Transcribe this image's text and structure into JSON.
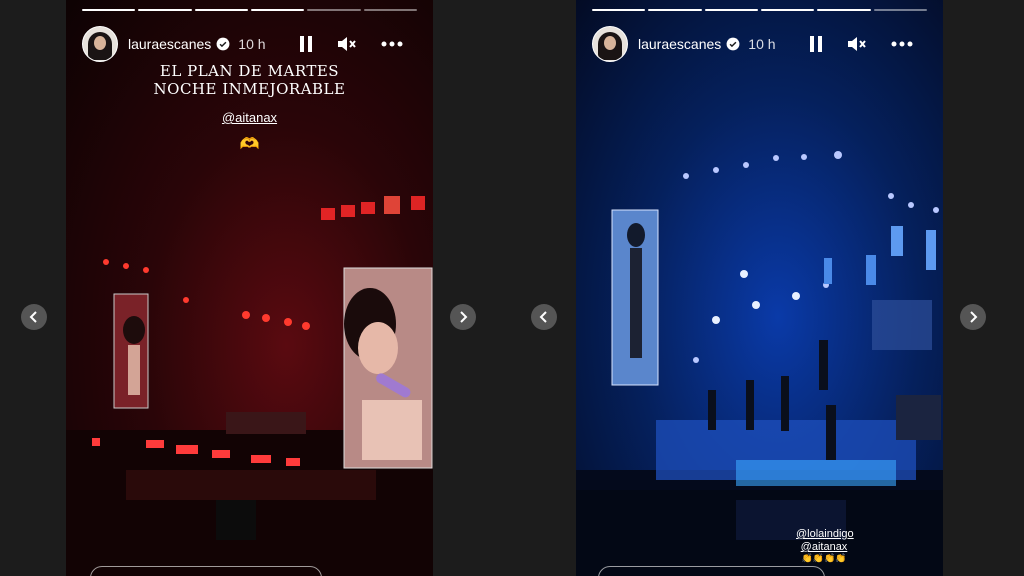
{
  "stories": [
    {
      "username": "lauraescanes",
      "time": "10 h",
      "caption_line1": "EL PLAN DE MARTES",
      "caption_line2": "NOCHE INMEJORABLE",
      "mention": "@aitanax",
      "emoji": "🫶"
    },
    {
      "username": "lauraescanes",
      "time": "10 h",
      "mention1": "@lolaindigo",
      "mention2": "@aitanax",
      "emoji": "👏👏👏👏"
    }
  ],
  "icons": {
    "verified": "verified-badge-icon",
    "pause": "pause-icon",
    "mute": "muted-speaker-icon",
    "more": "more-options-icon",
    "prev": "chevron-left-icon",
    "next": "chevron-right-icon"
  }
}
